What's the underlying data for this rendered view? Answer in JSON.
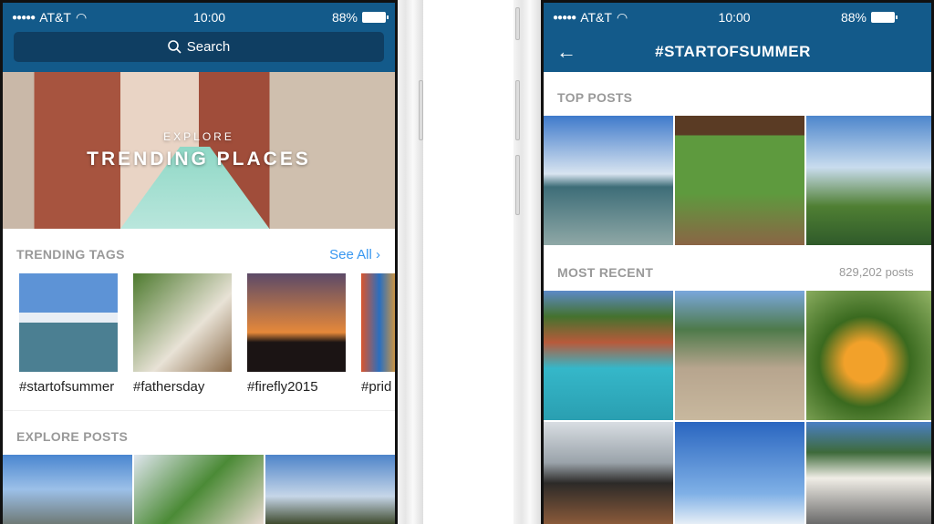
{
  "left_phone": {
    "status": {
      "carrier": "AT&T",
      "time": "10:00",
      "battery": "88%"
    },
    "search": {
      "placeholder": "Search"
    },
    "hero": {
      "kicker": "EXPLORE",
      "title": "TRENDING PLACES"
    },
    "trending_tags": {
      "header": "TRENDING TAGS",
      "see_all": "See All",
      "tags": [
        "#startofsummer",
        "#fathersday",
        "#firefly2015",
        "#prid"
      ]
    },
    "explore_posts": {
      "header": "EXPLORE POSTS"
    }
  },
  "right_phone": {
    "status": {
      "carrier": "AT&T",
      "time": "10:00",
      "battery": "88%"
    },
    "nav": {
      "title": "#STARTOFSUMMER"
    },
    "top_posts": {
      "header": "TOP POSTS"
    },
    "most_recent": {
      "header": "MOST RECENT",
      "count": "829,202 posts"
    }
  },
  "colors": {
    "nav_blue": "#135a8a",
    "search_box": "#0f3e62",
    "link_blue": "#3897f0",
    "section_gray": "#999999"
  }
}
